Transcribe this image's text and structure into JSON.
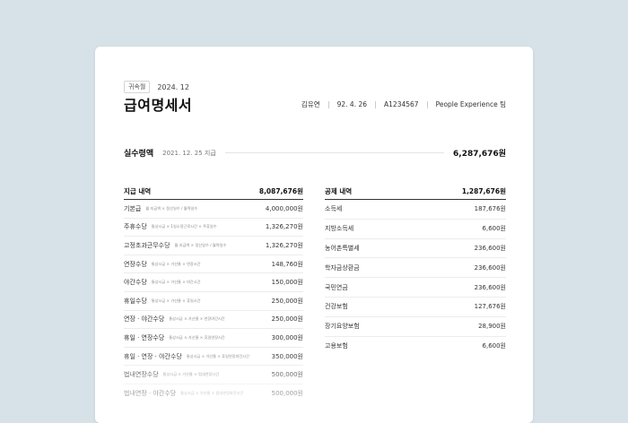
{
  "header": {
    "badge": "귀속월",
    "period": "2024. 12",
    "title": "급여명세서",
    "employee": {
      "name": "김유연",
      "birth": "92. 4. 26",
      "id": "A1234567",
      "team": "People Experience 팀"
    }
  },
  "net_pay": {
    "label": "실수령액",
    "date": "2021. 12. 25 지급",
    "amount": "6,287,676원"
  },
  "payments": {
    "title": "지급 내역",
    "total": "8,087,676원",
    "items": [
      {
        "name": "기본급",
        "desc": "월 지급액 × 정산일수 / 월력일수",
        "amount": "4,000,000원"
      },
      {
        "name": "주휴수당",
        "desc": "통상시급 × 1일소정근로시간 × 주휴일수",
        "amount": "1,326,270원"
      },
      {
        "name": "고정초과근무수당",
        "desc": "월 지급액 × 정산일수 / 월력일수",
        "amount": "1,326,270원"
      },
      {
        "name": "연장수당",
        "desc": "통상시급 × 가산율 × 연장시간",
        "amount": "148,760원"
      },
      {
        "name": "야간수당",
        "desc": "통상시급 × 가산율 × 야간시간",
        "amount": "150,000원"
      },
      {
        "name": "휴일수당",
        "desc": "통상시급 × 가산율 × 휴일시간",
        "amount": "250,000원"
      },
      {
        "name": "연장 · 야간수당",
        "desc": "통상시급 × 가산율 × 연장야간시간",
        "amount": "250,000원"
      },
      {
        "name": "휴일 · 연장수당",
        "desc": "통상시급 × 가산율 × 휴일연장시간",
        "amount": "300,000원"
      },
      {
        "name": "휴일 · 연장 · 야간수당",
        "desc": "통상시급 × 가산율 × 휴일연장야간시간",
        "amount": "350,000원"
      },
      {
        "name": "법내연장수당",
        "desc": "통상시급 × 가산율 × 법내연장시간",
        "amount": "500,000원"
      },
      {
        "name": "법내연장 · 야간수당",
        "desc": "통상시급 × 가산율 × 법내연장야간시간",
        "amount": "500,000원"
      }
    ]
  },
  "deductions": {
    "title": "공제 내역",
    "total": "1,287,676원",
    "items": [
      {
        "name": "소득세",
        "amount": "187,676원"
      },
      {
        "name": "지방소득세",
        "amount": "6,600원"
      },
      {
        "name": "농어촌특별세",
        "amount": "236,600원"
      },
      {
        "name": "학자금상환금",
        "amount": "236,600원"
      },
      {
        "name": "국민연금",
        "amount": "236,600원"
      },
      {
        "name": "건강보험",
        "amount": "127,676원"
      },
      {
        "name": "장기요양보험",
        "amount": "28,900원"
      },
      {
        "name": "고용보험",
        "amount": "6,600원"
      }
    ]
  }
}
